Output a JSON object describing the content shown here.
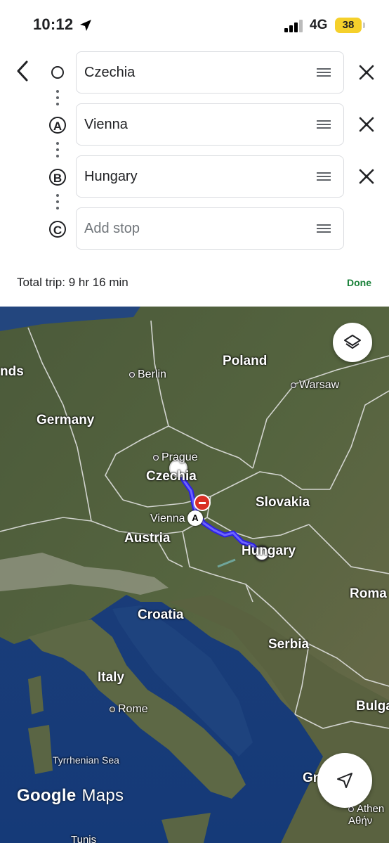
{
  "status_bar": {
    "time": "10:12",
    "network": "4G",
    "battery": "38"
  },
  "directions": {
    "stops": [
      {
        "marker": "",
        "value": "Czechia"
      },
      {
        "marker": "A",
        "value": "Vienna"
      },
      {
        "marker": "B",
        "value": "Hungary"
      },
      {
        "marker": "C",
        "placeholder": "Add stop"
      }
    ],
    "total_trip": "Total trip: 9 hr 16 min",
    "done_label": "Done"
  },
  "map": {
    "countries": [
      "nds",
      "Poland",
      "Germany",
      "Czechia",
      "Slovakia",
      "Austria",
      "Hungary",
      "Croatia",
      "Serbia",
      "Italy",
      "Roma",
      "Bulga",
      "Gr"
    ],
    "cities": [
      "Berlin",
      "Warsaw",
      "Prague",
      "Vienna",
      "Rome",
      "Athen Αθήν",
      "Tunis"
    ],
    "sea": "Tyrrhenian Sea",
    "logo_google": "Google",
    "logo_maps": "Maps",
    "route_color": "#4a3cf0"
  }
}
